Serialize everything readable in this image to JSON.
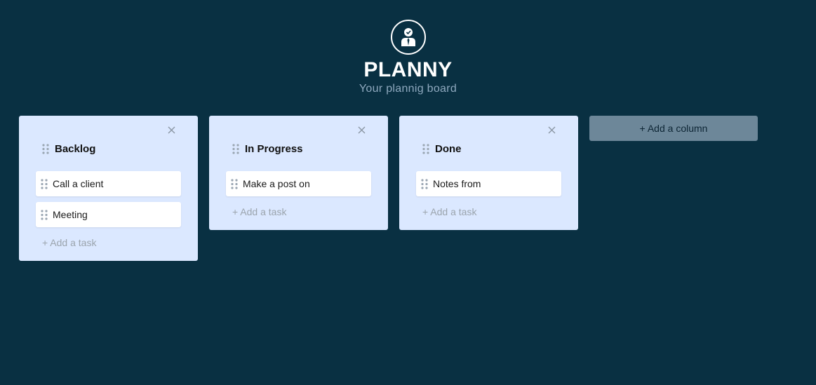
{
  "app": {
    "title": "PLANNY",
    "subtitle": "Your plannig board"
  },
  "colors": {
    "background": "#093042",
    "column": "#dbe8ff",
    "card": "#ffffff",
    "add_column_button": "#6d8799"
  },
  "icons": {
    "logo": "user-avatar-icon",
    "close": "close-icon",
    "drag": "drag-handle-icon"
  },
  "columns": [
    {
      "title": "Backlog",
      "tasks": [
        "Call a client",
        "Meeting"
      ],
      "add_task_label": "+ Add a task"
    },
    {
      "title": "In Progress",
      "tasks": [
        "Make a post on"
      ],
      "add_task_label": "+ Add a task"
    },
    {
      "title": "Done",
      "tasks": [
        "Notes from"
      ],
      "add_task_label": "+ Add a task"
    }
  ],
  "add_column_label": "+ Add a column"
}
